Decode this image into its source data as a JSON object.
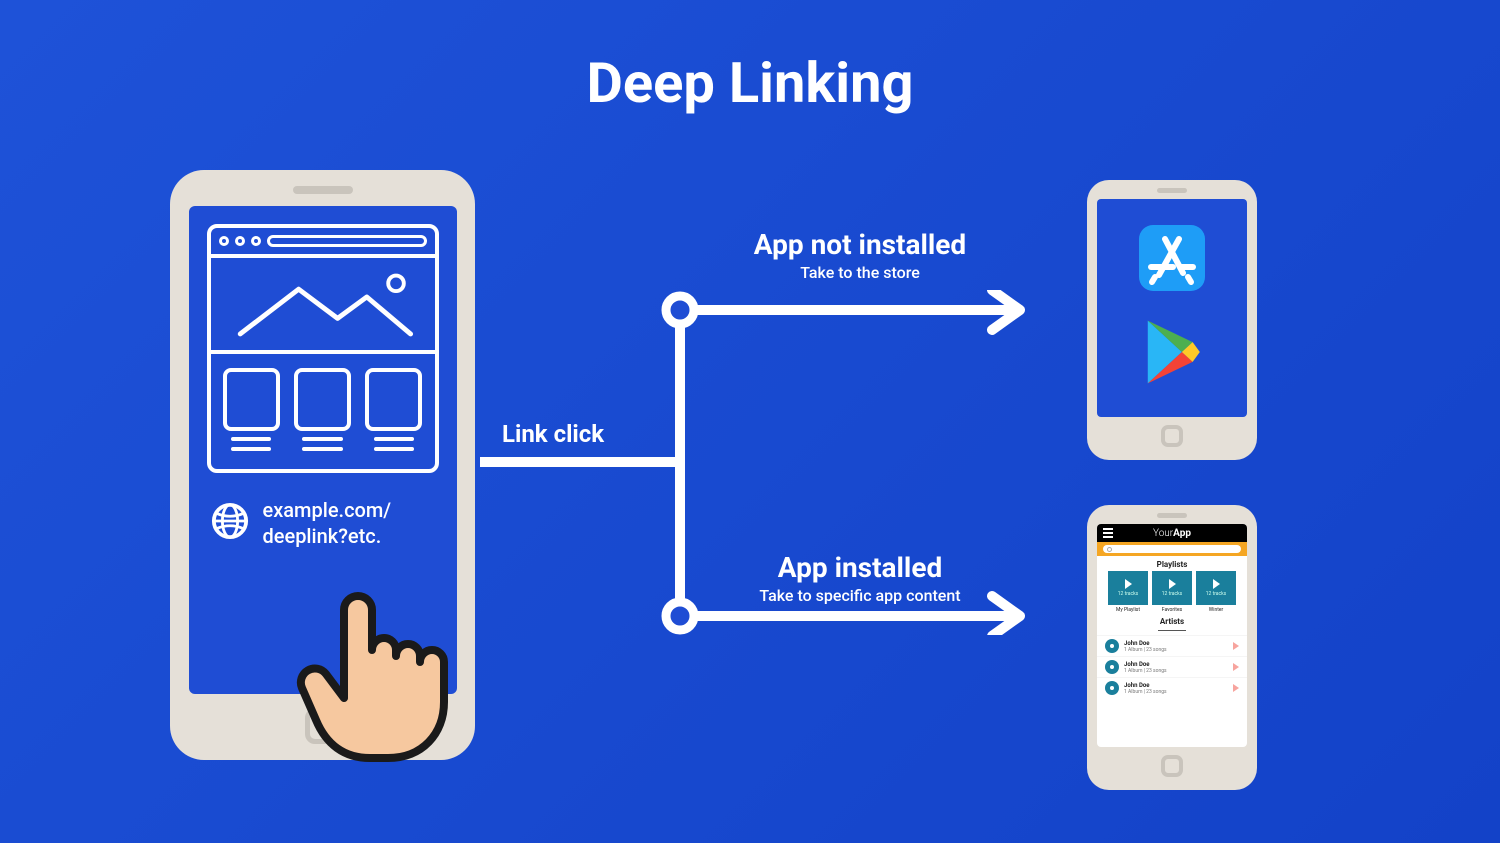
{
  "title": "Deep Linking",
  "source": {
    "url_line1": "example.com/",
    "url_line2": "deeplink?etc."
  },
  "flow": {
    "link_label": "Link click",
    "top": {
      "heading": "App not installed",
      "sub": "Take to the store"
    },
    "bottom": {
      "heading": "App installed",
      "sub": "Take to specific app content"
    }
  },
  "app": {
    "brand": "YourApp",
    "section_playlists": "Playlists",
    "section_artists": "Artists",
    "track_count": "12 tracks",
    "playlists": [
      "My Playlist",
      "Favorites",
      "Winter"
    ],
    "artist": {
      "name": "John Doe",
      "sub": "1 Album | 23 songs"
    }
  }
}
